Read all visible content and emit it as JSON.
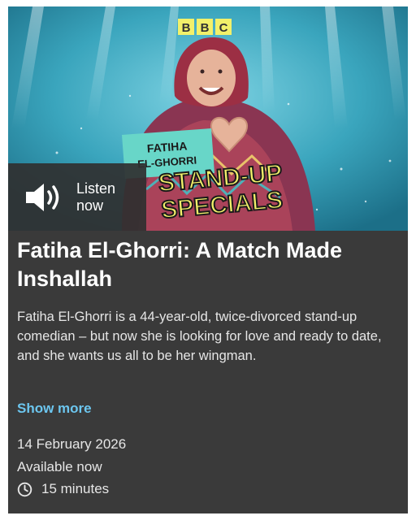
{
  "hero": {
    "brand_letters": [
      "B",
      "B",
      "C"
    ],
    "show_name_line1": "FATIHA",
    "show_name_line2": "EL-GHORRI",
    "series_title_line1": "STAND-UP",
    "series_title_line2": "SPECIALS",
    "listen_label": "Listen now",
    "speaker_icon": "speaker-icon"
  },
  "episode": {
    "title": "Fatiha El-Ghorri: A Match Made Inshallah",
    "description": "Fatiha El-Ghorri is a 44-year-old, twice-divorced stand-up comedian – but now she is looking for love and ready to date, and she wants us all to be her wingman.",
    "show_more": "Show more",
    "date": "14 February 2026",
    "availability": "Available now",
    "duration": "15 minutes",
    "duration_icon": "clock-icon"
  },
  "colors": {
    "card_background": "#3a3a3a",
    "accent_link": "#6cc6ef",
    "brand_yellow": "#f2f06a",
    "stage_blue": "#2f9ab3"
  }
}
